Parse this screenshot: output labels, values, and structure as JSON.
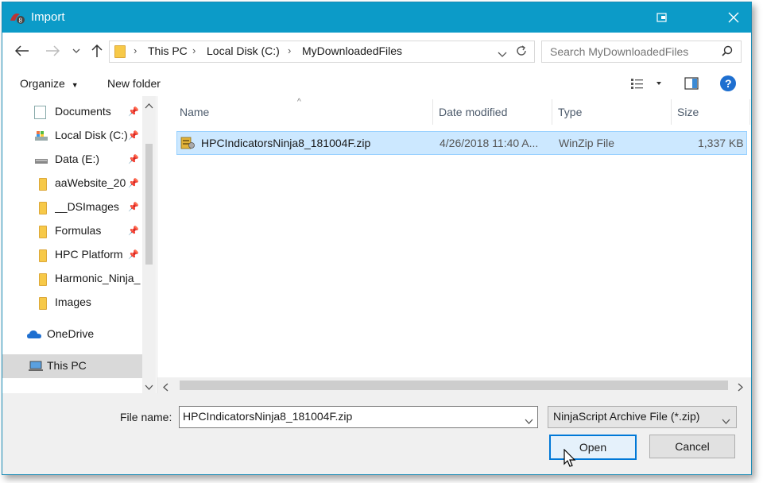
{
  "window": {
    "title": "Import"
  },
  "address": {
    "crumbs": [
      "This PC",
      "Local Disk (C:)",
      "MyDownloadedFiles"
    ]
  },
  "search": {
    "placeholder": "Search MyDownloadedFiles"
  },
  "toolbar": {
    "organize_label": "Organize",
    "new_folder_label": "New folder"
  },
  "nav": {
    "items": [
      {
        "label": "Documents",
        "icon": "documents-icon",
        "pinned": true
      },
      {
        "label": "Local Disk (C:)",
        "icon": "local-disk-icon",
        "pinned": true
      },
      {
        "label": "Data (E:)",
        "icon": "drive-icon",
        "pinned": true
      },
      {
        "label": "aaWebsite_20",
        "icon": "folder-icon",
        "pinned": true
      },
      {
        "label": "__DSImages",
        "icon": "folder-icon",
        "pinned": true
      },
      {
        "label": "Formulas",
        "icon": "folder-icon",
        "pinned": true
      },
      {
        "label": "HPC Platform",
        "icon": "folder-icon",
        "pinned": true
      },
      {
        "label": "Harmonic_Ninja_",
        "icon": "folder-icon",
        "pinned": false
      },
      {
        "label": "Images",
        "icon": "folder-icon",
        "pinned": false
      }
    ],
    "onedrive_label": "OneDrive",
    "thispc_label": "This PC"
  },
  "columns": {
    "name": "Name",
    "date": "Date modified",
    "type": "Type",
    "size": "Size"
  },
  "files": [
    {
      "name": "HPCIndicatorsNinja8_181004F.zip",
      "date": "4/26/2018 11:40 A...",
      "type": "WinZip File",
      "size": "1,337 KB"
    }
  ],
  "bottom": {
    "file_name_label": "File name:",
    "file_name_value": "HPCIndicatorsNinja8_181004F.zip",
    "filter_value": "NinjaScript Archive File (*.zip)",
    "open_label": "Open",
    "cancel_label": "Cancel"
  },
  "colors": {
    "titlebar": "#0c9bc8",
    "selection": "#cce8ff",
    "accent": "#0078d7"
  }
}
